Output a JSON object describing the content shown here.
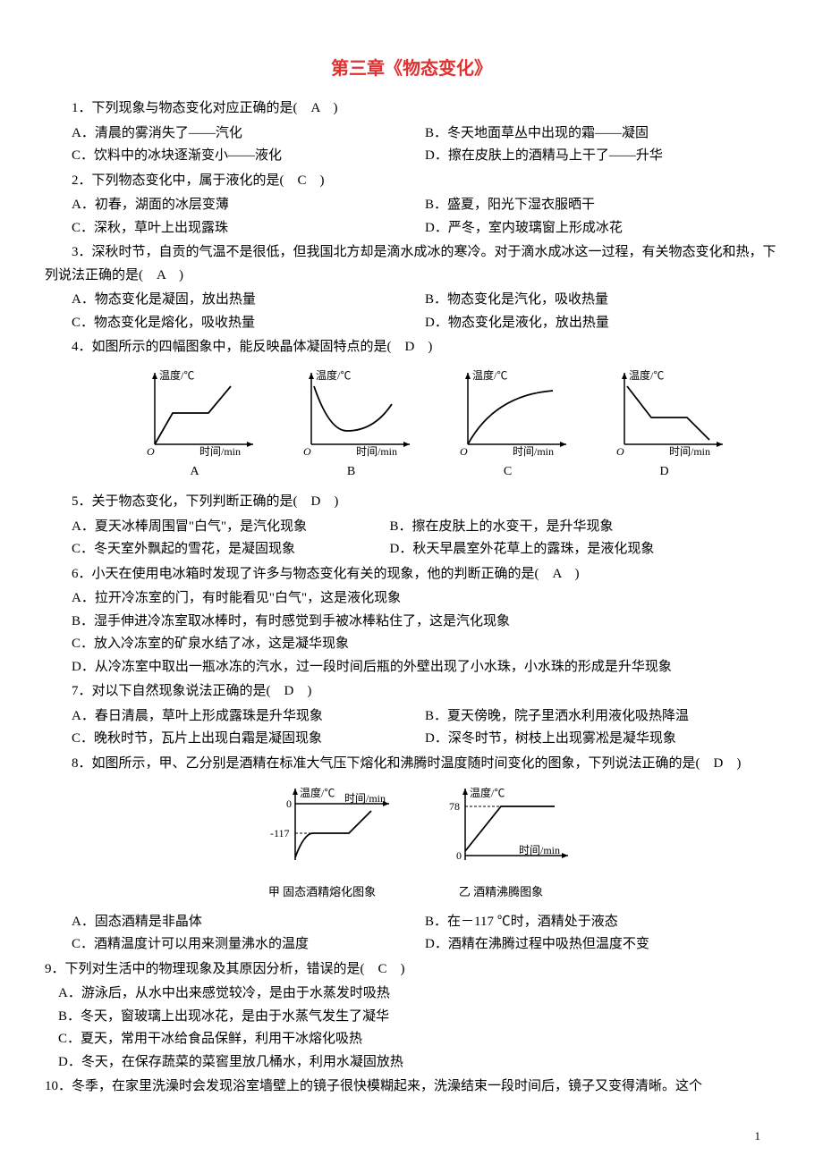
{
  "title": "第三章《物态变化》",
  "q1": {
    "stem": "1．下列现象与物态变化对应正确的是(　A　)",
    "A": "A．清晨的雾消失了——汽化",
    "B": "B．冬天地面草丛中出现的霜——凝固",
    "C": "C．饮料中的冰块逐渐变小——液化",
    "D": "D．擦在皮肤上的酒精马上干了——升华"
  },
  "q2": {
    "stem": "2．下列物态变化中，属于液化的是(　C　)",
    "A": "A．初春，湖面的冰层变薄",
    "B": "B．盛夏，阳光下湿衣服晒干",
    "C": "C．深秋，草叶上出现露珠",
    "D": "D．严冬，室内玻璃窗上形成冰花"
  },
  "q3": {
    "stem": "3．深秋时节，自贡的气温不是很低，但我国北方却是滴水成冰的寒冷。对于滴水成冰这一过程，有关物态变化和热，下列说法正确的是(　A　)",
    "A": "A．物态变化是凝固，放出热量",
    "B": "B．物态变化是汽化，吸收热量",
    "C": "C．物态变化是熔化，吸收热量",
    "D": "D．物态变化是液化，放出热量"
  },
  "q4": {
    "stem": "4．如图所示的四幅图象中，能反映晶体凝固特点的是(　D　)",
    "yaxis": "温度/℃",
    "xaxis": "时间/min",
    "labels": {
      "A": "A",
      "B": "B",
      "C": "C",
      "D": "D"
    }
  },
  "q5": {
    "stem": "5．关于物态变化，下列判断正确的是(　D　)",
    "A": "A．夏天冰棒周围冒\"白气\"，是汽化现象",
    "B": "B．擦在皮肤上的水变干，是升华现象",
    "C": "C．冬天室外飘起的雪花，是凝固现象",
    "D": "D．秋天早晨室外花草上的露珠，是液化现象"
  },
  "q6": {
    "stem": "6．小天在使用电冰箱时发现了许多与物态变化有关的现象，他的判断正确的是(　A　)",
    "A": "A．拉开冷冻室的门，有时能看见\"白气\"，这是液化现象",
    "B": "B．湿手伸进冷冻室取冰棒时，有时感觉到手被冰棒粘住了，这是汽化现象",
    "C": "C．放入冷冻室的矿泉水结了冰，这是凝华现象",
    "D": "D．从冷冻室中取出一瓶冰冻的汽水，过一段时间后瓶的外壁出现了小水珠，小水珠的形成是升华现象"
  },
  "q7": {
    "stem": "7．对以下自然现象说法正确的是(　D　)",
    "A": "A．春日清晨，草叶上形成露珠是升华现象",
    "B": "B．夏天傍晚，院子里洒水利用液化吸热降温",
    "C": "C．晚秋时节，瓦片上出现白霜是凝固现象",
    "D": "D．深冬时节，树枝上出现雾凇是凝华现象"
  },
  "q8": {
    "stem": "8．如图所示，甲、乙分别是酒精在标准大气压下熔化和沸腾时温度随时间变化的图象，下列说法正确的是(　D　)",
    "yaxis": "温度/℃",
    "xaxis": "时间/min",
    "val0": "0",
    "val78": "78",
    "valNeg117": "-117",
    "captionA": "甲 固态酒精熔化图象",
    "captionB": "乙 酒精沸腾图象",
    "A": "A．固态酒精是非晶体",
    "B": "B．在－117 ℃时，酒精处于液态",
    "C": "C．酒精温度计可以用来测量沸水的温度",
    "D": "D．酒精在沸腾过程中吸热但温度不变"
  },
  "q9": {
    "stem": "9．下列对生活中的物理现象及其原因分析，错误的是(　C　)",
    "A": "A．游泳后，从水中出来感觉较冷，是由于水蒸发时吸热",
    "B": "B．冬天，窗玻璃上出现冰花，是由于水蒸气发生了凝华",
    "C": "C．夏天，常用干冰给食品保鲜，利用干冰熔化吸热",
    "D": "D．冬天，在保存蔬菜的菜窖里放几桶水，利用水凝固放热"
  },
  "q10": {
    "stem": "10．冬季，在家里洗澡时会发现浴室墙壁上的镜子很快模糊起来，洗澡结束一段时间后，镜子又变得清晰。这个"
  },
  "pageNum": "1"
}
